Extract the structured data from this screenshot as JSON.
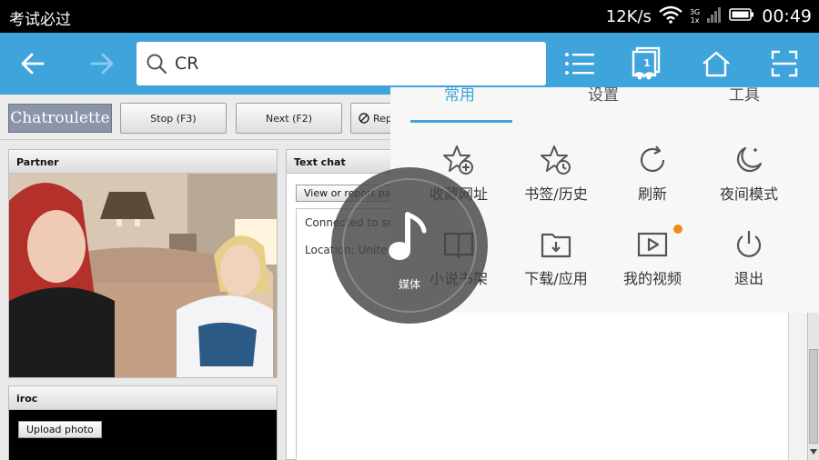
{
  "status_bar": {
    "app_title": "考试必过",
    "speed": "12K/s",
    "network_3g": "3G",
    "network_1x": "1x",
    "time": "00:49"
  },
  "toolbar": {
    "url_text": "CR",
    "tab_count": "1"
  },
  "page": {
    "logo": "Chatroulette",
    "stop_button": "Stop (F3)",
    "next_button": "Next (F2)",
    "report_button": "Rep",
    "partner_title": "Partner",
    "self_title": "iroc",
    "upload_button": "Upload photo",
    "text_chat_title": "Text chat",
    "view_report_button": "View or report past",
    "chat_connected": "Connected to so",
    "chat_location": "Location: United"
  },
  "menu": {
    "tabs": [
      "常用",
      "设置",
      "工具"
    ],
    "items": [
      {
        "label": "收藏网址",
        "icon": "star-plus-icon"
      },
      {
        "label": "书签/历史",
        "icon": "star-clock-icon"
      },
      {
        "label": "刷新",
        "icon": "refresh-icon"
      },
      {
        "label": "夜间模式",
        "icon": "moon-icon"
      },
      {
        "label": "小说书架",
        "icon": "book-icon"
      },
      {
        "label": "下载/应用",
        "icon": "download-folder-icon"
      },
      {
        "label": "我的视频",
        "icon": "video-play-icon"
      },
      {
        "label": "退出",
        "icon": "power-icon"
      }
    ],
    "badge_color": "#f08a1c"
  },
  "media_ball": {
    "label": "媒体",
    "icon": "music-note-icon"
  },
  "colors": {
    "accent": "#3fa3dc",
    "status_bar": "#000000"
  }
}
